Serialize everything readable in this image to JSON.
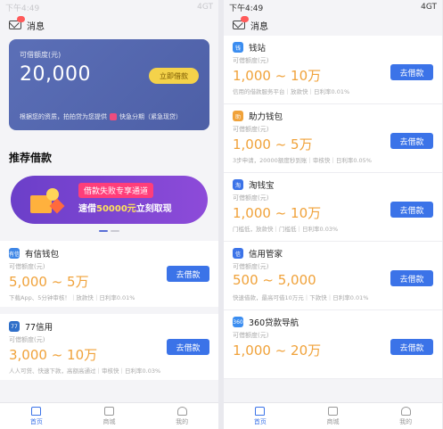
{
  "left": {
    "status": {
      "time": "下午4:49",
      "signal": "4GT"
    },
    "message_label": "消息",
    "quota": {
      "label": "可借额度(元)",
      "value": "20,000",
      "button": "立即借款",
      "note": "根据您的资质，拍拍贷为您提供",
      "note_brand": "快急分期（紧急现贷）"
    },
    "recommend_title": "推荐借款",
    "banner": {
      "line1": "借款失败专享通道",
      "line2_prefix": "速借",
      "line2_highlight": "50000元",
      "line2_suffix": "立刻取现"
    },
    "items": [
      {
        "name": "有信钱包",
        "label": "可借额度(元)",
        "range": "5,000 ~ 5万",
        "desc": "下载App、5分钟审核！｜放款快｜日利率0.01%",
        "button": "去借款",
        "icon_color": "#3e86e6",
        "icon": "有信"
      },
      {
        "name": "77信用",
        "label": "可借额度(元)",
        "range": "3,000 ~ 10万",
        "desc": "人人可贷、快速下款，高额高通过｜审核快｜日利率0.03%",
        "button": "去借款",
        "icon_color": "#2f6fc9",
        "icon": "77"
      }
    ],
    "tabs": [
      {
        "label": "首页",
        "icon": "home-icon",
        "active": true
      },
      {
        "label": "商城",
        "icon": "shop-icon",
        "active": false
      },
      {
        "label": "我的",
        "icon": "user-icon",
        "active": false
      }
    ]
  },
  "right": {
    "status": {
      "time": "下午4:49",
      "signal": "4GT"
    },
    "message_label": "消息",
    "items": [
      {
        "name": "钱站",
        "label": "可借额度(元)",
        "range": "1,000 ~ 10万",
        "desc": "信用的借款服务平台｜放款快｜日利率0.01%",
        "button": "去借款",
        "icon_color": "#3b8df0",
        "icon": "钱"
      },
      {
        "name": "助力钱包",
        "label": "可借额度(元)",
        "range": "1,000 ~ 5万",
        "desc": "3步申请，20000额度秒到账｜审核快｜日利率0.05%",
        "button": "去借款",
        "icon_color": "#f0a23a",
        "icon": "助"
      },
      {
        "name": "淘钱宝",
        "label": "可借额度(元)",
        "range": "1,000 ~ 10万",
        "desc": "门槛低，放款快｜门槛低｜日利率0.03%",
        "button": "去借款",
        "icon_color": "#3b73e8",
        "icon": "淘"
      },
      {
        "name": "信用管家",
        "label": "可借额度(元)",
        "range": "500 ~ 5,000",
        "desc": "快速借款，最高可借10万元｜下款快｜日利率0.01%",
        "button": "去借款",
        "icon_color": "#3b73e8",
        "icon": "信"
      },
      {
        "name": "360贷款导航",
        "label": "可借额度(元)",
        "range": "1,000 ~ 20万",
        "desc": "",
        "button": "去借款",
        "icon_color": "#3b8df0",
        "icon": "360"
      }
    ],
    "tabs": [
      {
        "label": "首页",
        "icon": "home-icon",
        "active": true
      },
      {
        "label": "商城",
        "icon": "shop-icon",
        "active": false
      },
      {
        "label": "我的",
        "icon": "user-icon",
        "active": false
      }
    ]
  }
}
